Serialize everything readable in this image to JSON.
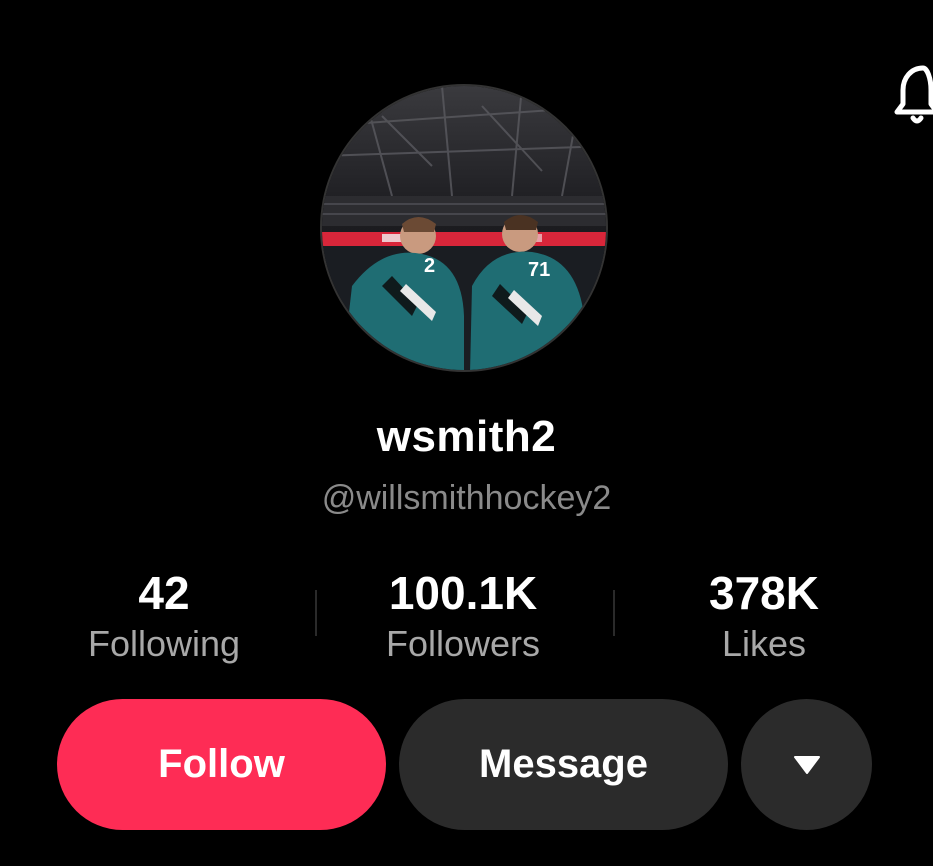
{
  "profile": {
    "username": "wsmith2",
    "handle": "@willsmithhockey2",
    "avatar_icon": "profile-photo-hockey-players"
  },
  "stats": {
    "following": {
      "value": "42",
      "label": "Following"
    },
    "followers": {
      "value": "100.1K",
      "label": "Followers"
    },
    "likes": {
      "value": "378K",
      "label": "Likes"
    }
  },
  "actions": {
    "follow_label": "Follow",
    "message_label": "Message",
    "more_icon": "triangle-down-icon"
  },
  "header": {
    "notification_icon": "bell-icon"
  },
  "colors": {
    "background": "#000000",
    "follow_button": "#fe2c55",
    "secondary_button": "#2b2b2b",
    "muted_text": "#8a8a8a"
  }
}
